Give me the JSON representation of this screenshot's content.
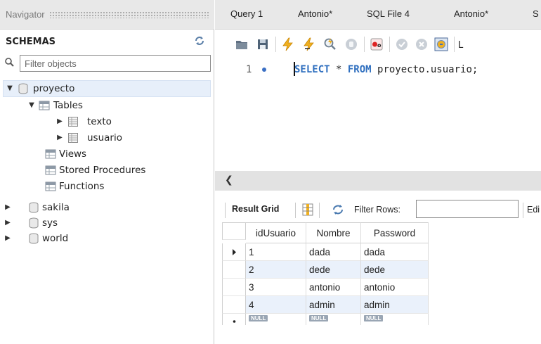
{
  "navigator": {
    "title": "Navigator",
    "schemas_label": "SCHEMAS",
    "filter_placeholder": "Filter objects",
    "tree": {
      "proyecto": "proyecto",
      "tables": "Tables",
      "texto": "texto",
      "usuario": "usuario",
      "views": "Views",
      "stored_procedures": "Stored Procedures",
      "functions": "Functions",
      "sakila": "sakila",
      "sys": "sys",
      "world": "world"
    }
  },
  "tabs": [
    "Query 1",
    "Antonio*",
    "SQL File 4",
    "Antonio*",
    "S"
  ],
  "editor": {
    "line_number": "1",
    "keyword_select": "SELECT",
    "star": " * ",
    "keyword_from": "FROM",
    "rest": " proyecto.usuario;"
  },
  "result_bar": {
    "result_grid_label": "Result Grid",
    "filter_rows_label": "Filter Rows:",
    "edit_label": "Edi"
  },
  "grid": {
    "columns": [
      "idUsuario",
      "Nombre",
      "Password"
    ],
    "rows": [
      [
        "1",
        "dada",
        "dada"
      ],
      [
        "2",
        "dede",
        "dede"
      ],
      [
        "3",
        "antonio",
        "antonio"
      ],
      [
        "4",
        "admin",
        "admin"
      ]
    ],
    "null_label": "NULL"
  },
  "toolbar_icons": [
    "open-folder-icon",
    "save-icon",
    "execute-icon",
    "execute-current-icon",
    "explain-icon",
    "stop-icon",
    "toggle-error-icon",
    "commit-icon",
    "rollback-icon",
    "autocommit-icon",
    "limit-icon"
  ]
}
